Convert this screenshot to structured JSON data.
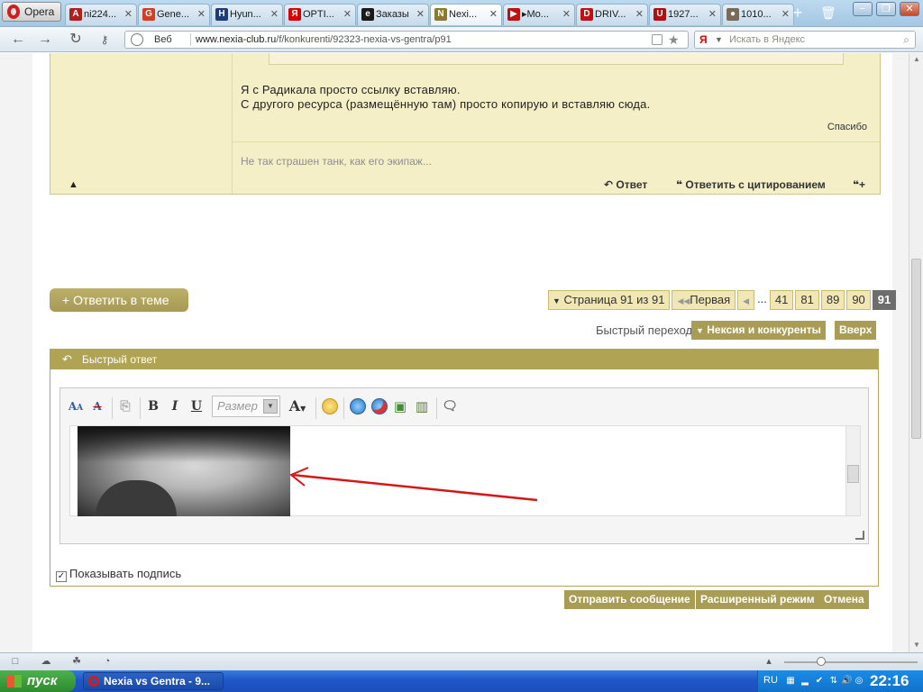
{
  "browser": {
    "menu_label": "Opera",
    "tabs": [
      {
        "title": "ni224...",
        "fav": "A",
        "color": "#b01e1e"
      },
      {
        "title": "Gene...",
        "fav": "G",
        "color": "#d04020"
      },
      {
        "title": "Hyun...",
        "fav": "H",
        "color": "#1d3c7a"
      },
      {
        "title": "OPTI...",
        "fav": "Я",
        "color": "#d80000"
      },
      {
        "title": "Заказы",
        "fav": "e",
        "color": "#1a1a1a"
      },
      {
        "title": "Nexi...",
        "fav": "N",
        "color": "#8a7a2a"
      },
      {
        "title": "▸Mo...",
        "fav": "▶",
        "color": "#c01010"
      },
      {
        "title": "DRIV...",
        "fav": "D",
        "color": "#c01010"
      },
      {
        "title": "1927...",
        "fav": "U",
        "color": "#b01010"
      },
      {
        "title": "1010...",
        "fav": "●",
        "color": "#7a6a5a"
      }
    ],
    "address": {
      "web_label": "Веб",
      "url_host": "www.nexia-club.ru",
      "url_path": "/f/konkurenti/92323-nexia-vs-gentra/p91"
    },
    "search_placeholder": "Искать в Яндекс"
  },
  "post": {
    "text_line1": "Я с Радикала просто ссылку вставляю.",
    "text_line2": "С другого ресурса (размещённую там) просто копирую и вставляю сюда.",
    "thanks_label": "Спасибо",
    "signature": "Не так страшен танк, как его экипаж...",
    "reply_label": "Ответ",
    "quote_reply_label": "Ответить с цитированием"
  },
  "reply_topic_label": "+ Ответить в теме",
  "pagination": {
    "page_info": "Страница 91 из 91",
    "first_label": "Первая",
    "pages": [
      "41",
      "81",
      "89",
      "90"
    ],
    "current": "91"
  },
  "quick_nav": {
    "label": "Быстрый переход",
    "forum_label": "Нексия и конкуренты",
    "top_label": "Вверх"
  },
  "quick_reply": {
    "title": "Быстрый ответ",
    "size_placeholder": "Размер",
    "show_signature_label": "Показывать подпись",
    "show_signature_checked": true,
    "submit_label": "Отправить сообщение",
    "advanced_label": "Расширенный режим",
    "cancel_label": "Отмена"
  },
  "taskbar": {
    "start_label": "пуск",
    "task_label": "Nexia vs Gentra - 9...",
    "lang": "RU",
    "clock": "22:16"
  },
  "colors": {
    "accent": "#b0a353",
    "post_bg": "#f5efc8",
    "arrow": "#d41818"
  }
}
